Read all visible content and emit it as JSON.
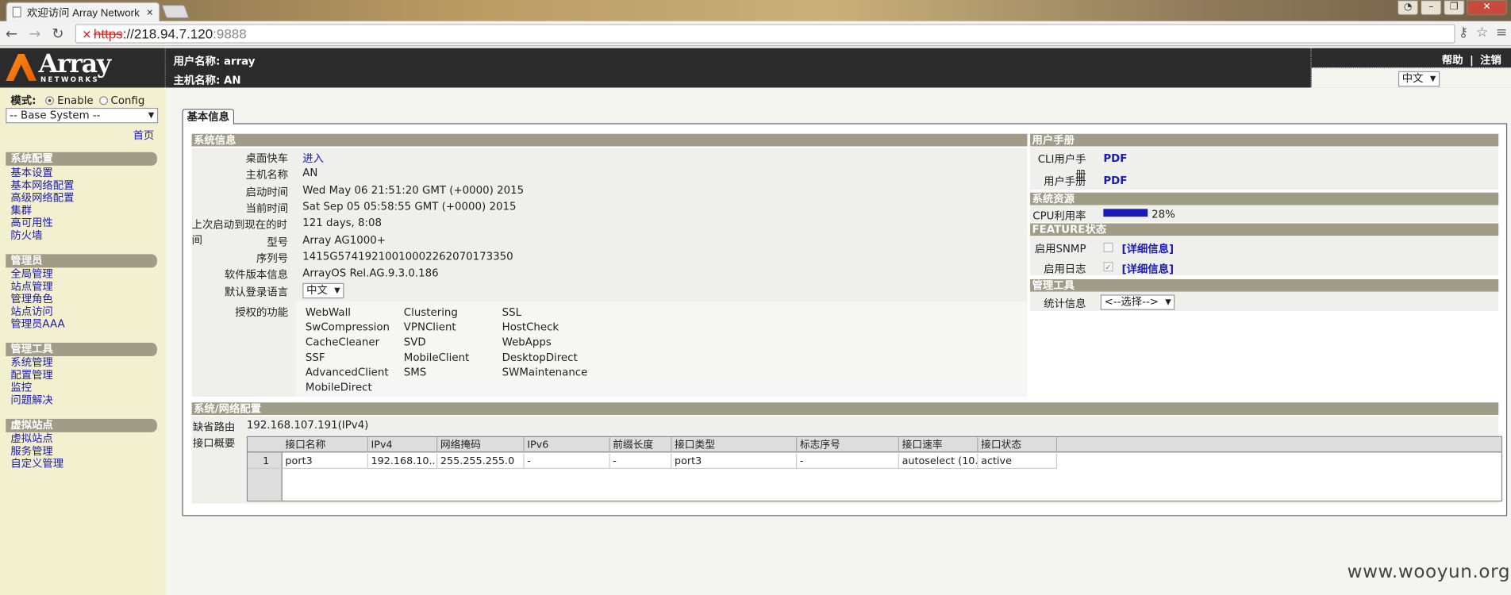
{
  "browser": {
    "tab_title": "欢迎访问 Array Network",
    "url_scheme": "https",
    "url_sep": "://",
    "url_host": "218.94.7.120",
    "url_port": ":9888"
  },
  "header": {
    "logo_text": "Array",
    "logo_sub": "NETWORKS",
    "username_label": "用户名称: array",
    "hostname_label": "主机名称: AN",
    "help": "帮助",
    "sep": "|",
    "logout": "注销",
    "lang": "中文"
  },
  "sidebar": {
    "mode_label": "模式:",
    "mode_enable": "Enable",
    "mode_config": "Config",
    "system_select": "-- Base System --",
    "home": "首页",
    "sections": [
      {
        "title": "系统配置",
        "items": [
          "基本设置",
          "基本网络配置",
          "高级网络配置",
          "集群",
          "高可用性",
          "防火墙"
        ]
      },
      {
        "title": "管理员",
        "items": [
          "全局管理",
          "站点管理",
          "管理角色",
          "站点访问",
          "管理员AAA"
        ]
      },
      {
        "title": "管理工具",
        "items": [
          "系统管理",
          "配置管理",
          "监控",
          "问题解决"
        ]
      },
      {
        "title": "虚拟站点",
        "items": [
          "虚拟站点",
          "服务管理",
          "自定义管理"
        ]
      }
    ]
  },
  "main": {
    "tab": "基本信息",
    "sysinfo_title": "系统信息",
    "rows": [
      {
        "label": "桌面快车",
        "value": "进入"
      },
      {
        "label": "主机名称",
        "value": "AN"
      },
      {
        "label": "启动时间",
        "value": "Wed May 06 21:51:20 GMT (+0000) 2015"
      },
      {
        "label": "当前时间",
        "value": "Sat Sep 05 05:58:55 GMT (+0000) 2015"
      },
      {
        "label": "上次启动到现在的时间",
        "value": "121 days, 8:08"
      },
      {
        "label": "型号",
        "value": "Array AG1000+"
      },
      {
        "label": "序列号",
        "value": "1415G5741921001000226207017335​0"
      },
      {
        "label": "软件版本信息",
        "value": "ArrayOS Rel.AG.9.3.0.186"
      },
      {
        "label": "默认登录语言",
        "value": "中文"
      }
    ],
    "features_label": "授权的功能",
    "features": [
      [
        "WebWall",
        "Clustering",
        "SSL"
      ],
      [
        "SwCompression",
        "VPNClient",
        "HostCheck"
      ],
      [
        "CacheCleaner",
        "SVD",
        "WebApps"
      ],
      [
        "SSF",
        "MobileClient",
        "DesktopDirect"
      ],
      [
        "AdvancedClient",
        "SMS",
        "SWMaintenance"
      ],
      [
        "MobileDirect",
        "",
        ""
      ]
    ],
    "manual_title": "用户手册",
    "cli_manual_label": "CLI用户手册",
    "cli_manual_link": "PDF",
    "user_manual_label": "用户手册",
    "user_manual_link": "PDF",
    "resource_title": "系统资源",
    "cpu_label": "CPU利用率",
    "cpu_percent": "28%",
    "cpu_fraction": 0.28,
    "feature_title": "FEATURE状态",
    "snmp_label": "启用SNMP",
    "snmp_detail": "[详细信息]",
    "log_label": "启用日志",
    "log_detail": "[详细信息]",
    "tools_title": "管理工具",
    "stats_label": "统计信息",
    "stats_select": "<--选择-->",
    "net_title": "系统/网络配置",
    "default_route_label": "缺省路由",
    "default_route": "192.168.107.191(IPv4)",
    "iface_label": "接口概要",
    "iface_headers": [
      "接口名称",
      "IPv4",
      "网络掩码",
      "IPv6",
      "前缀长度",
      "接口类型",
      "标志序号",
      "接口速率",
      "接口状态"
    ],
    "iface_rows": [
      {
        "num": "1",
        "cells": [
          "port3",
          "192.168.10...",
          "255.255.255.0",
          "-",
          "-",
          "port3",
          "-",
          "autoselect (10...",
          "active"
        ]
      }
    ]
  },
  "watermark": "www.wooyun.org"
}
